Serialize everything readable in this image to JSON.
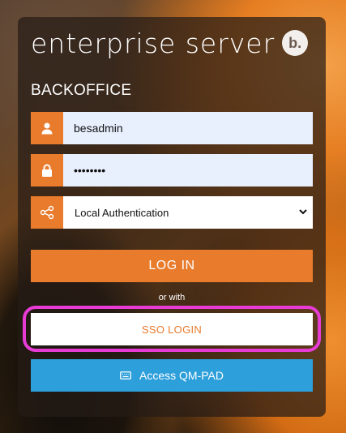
{
  "brand": {
    "name": "enterprise server",
    "badge": "b."
  },
  "form": {
    "title": "BACKOFFICE",
    "username": {
      "value": "besadmin",
      "icon": "user-icon"
    },
    "password": {
      "value": "••••••••",
      "icon": "lock-icon"
    },
    "auth_method": {
      "selected": "Local Authentication",
      "icon": "share-icon"
    }
  },
  "buttons": {
    "login": "LOG IN",
    "or_with": "or with",
    "sso": "SSO LOGIN",
    "qm_pad": "Access QM-PAD"
  },
  "colors": {
    "accent": "#e87b2c",
    "sso_highlight": "#e83bd6",
    "qm_pad": "#2d9fdb",
    "input_bg": "#e8f0fe"
  }
}
